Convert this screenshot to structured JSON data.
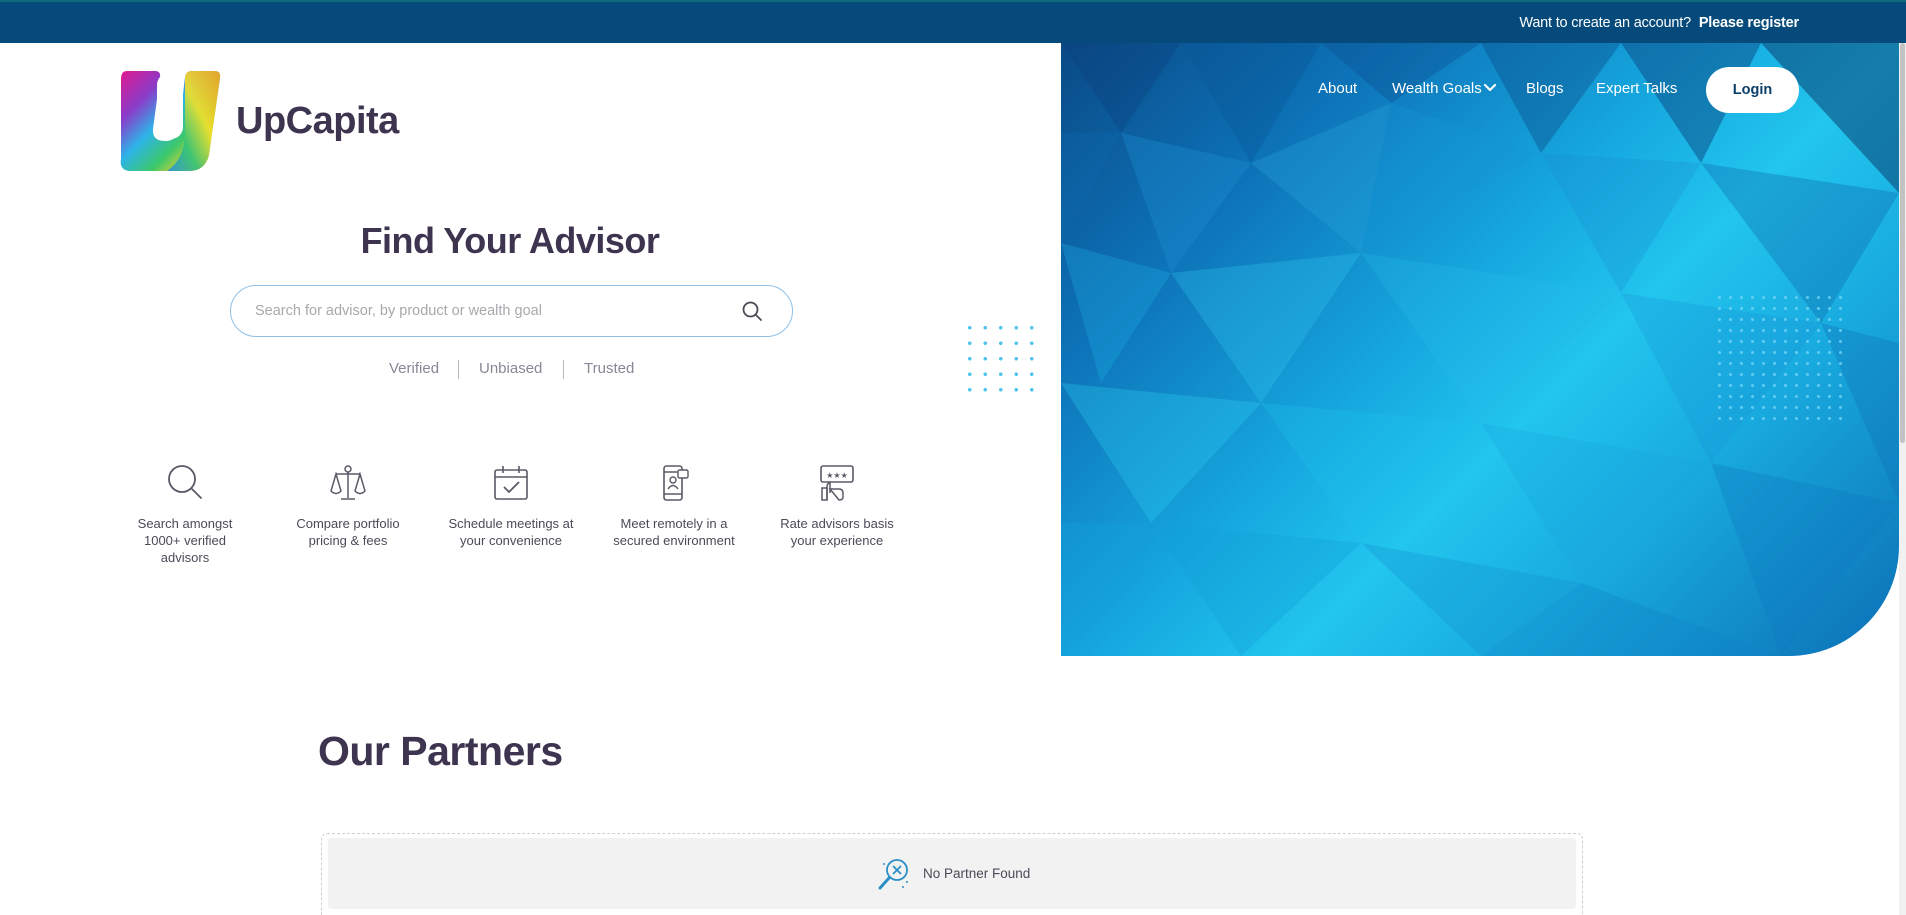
{
  "topbar": {
    "prompt": "Want to create an account?",
    "register_label": "Please register"
  },
  "brand": {
    "name": "UpCapita"
  },
  "nav": {
    "items": [
      "About",
      "Wealth Goals",
      "Blogs",
      "Expert Talks"
    ],
    "login_label": "Login"
  },
  "hero": {
    "title": "Find Your Advisor",
    "search_placeholder": "Search for advisor, by product or wealth goal",
    "tags": [
      "Verified",
      "Unbiased",
      "Trusted"
    ]
  },
  "features": [
    {
      "icon": "search-icon",
      "text": "Search amongst 1000+ verified advisors"
    },
    {
      "icon": "scale-icon",
      "text": "Compare portfolio pricing & fees"
    },
    {
      "icon": "calendar-check-icon",
      "text": "Schedule meetings at your convenience"
    },
    {
      "icon": "mobile-user-icon",
      "text": "Meet remotely in a secured environment"
    },
    {
      "icon": "rating-hand-icon",
      "text": "Rate advisors basis your experience"
    }
  ],
  "partners": {
    "title": "Our Partners",
    "empty_text": "No Partner Found"
  },
  "colors": {
    "topbar": "#054a7b",
    "heading": "#3d3450",
    "hero_accent": "#16a9e0"
  }
}
